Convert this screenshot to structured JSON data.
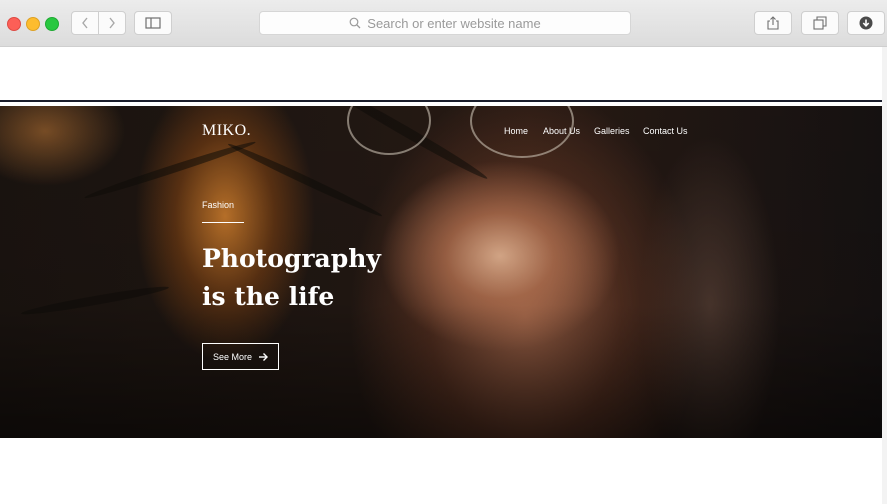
{
  "browser": {
    "address_placeholder": "Search or enter website name",
    "icons": {
      "back": "chevron-left-icon",
      "forward": "chevron-right-icon",
      "sidebar": "sidebar-icon",
      "search": "search-icon",
      "share": "share-icon",
      "tabs": "tabs-icon",
      "download": "download-icon"
    }
  },
  "site": {
    "logo": "MIKO.",
    "nav": [
      "Home",
      "About Us",
      "Galleries",
      "Contact Us"
    ]
  },
  "hero": {
    "eyebrow": "Fashion",
    "headline_line1": "Photography",
    "headline_line2": "is the life",
    "cta_label": "See More",
    "cta_icon": "arrow-right-icon"
  },
  "colors": {
    "accent_dark": "#1a1d2b",
    "hero_text": "#ffffff"
  }
}
